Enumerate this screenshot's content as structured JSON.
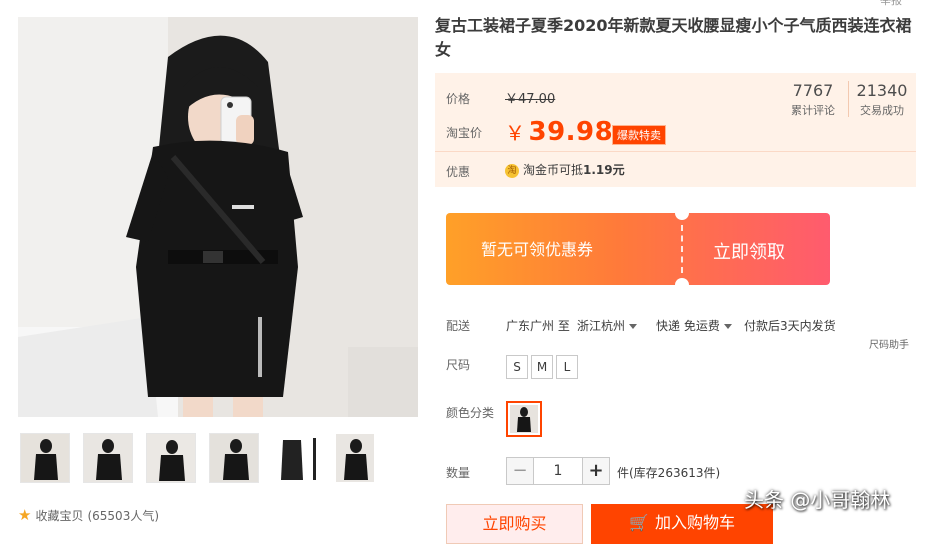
{
  "product": {
    "title": "复古工装裙子夏季2020年新款夏天收腰显瘦小个子气质西装连衣裙女",
    "report": "举报"
  },
  "price": {
    "orig_label": "价格",
    "orig_value": "￥47.00",
    "now_label": "淘宝价",
    "currency": "￥",
    "now_value": "39.98",
    "tag": "爆款特卖",
    "reviews_count": "7767",
    "reviews_label": "累计评论",
    "deals_count": "21340",
    "deals_label": "交易成功",
    "promo_label": "优惠",
    "promo_icon": "淘",
    "promo_text_prefix": "淘金币可抵",
    "promo_amount": "1.19元"
  },
  "coupon": {
    "left": "暂无可领优惠券",
    "right": "立即领取"
  },
  "delivery": {
    "label": "配送",
    "from": "广东广州 至",
    "to": "浙江杭州",
    "method": "快递 免运费",
    "promise": "付款后3天内发货",
    "helper": "尺码助手"
  },
  "size": {
    "label": "尺码",
    "options": [
      "S",
      "M",
      "L"
    ]
  },
  "color": {
    "label": "颜色分类"
  },
  "quantity": {
    "label": "数量",
    "minus": "−",
    "value": "1",
    "plus": "+",
    "stock": "件(库存263613件)"
  },
  "actions": {
    "buy": "立即购买",
    "cart": "加入购物车"
  },
  "collect": {
    "label": "收藏宝贝",
    "count": "(65503人气)"
  },
  "watermark": "头条 @小哥翰林",
  "colors": {
    "accent": "#ff4400",
    "price_bg": "#fff2e8"
  }
}
